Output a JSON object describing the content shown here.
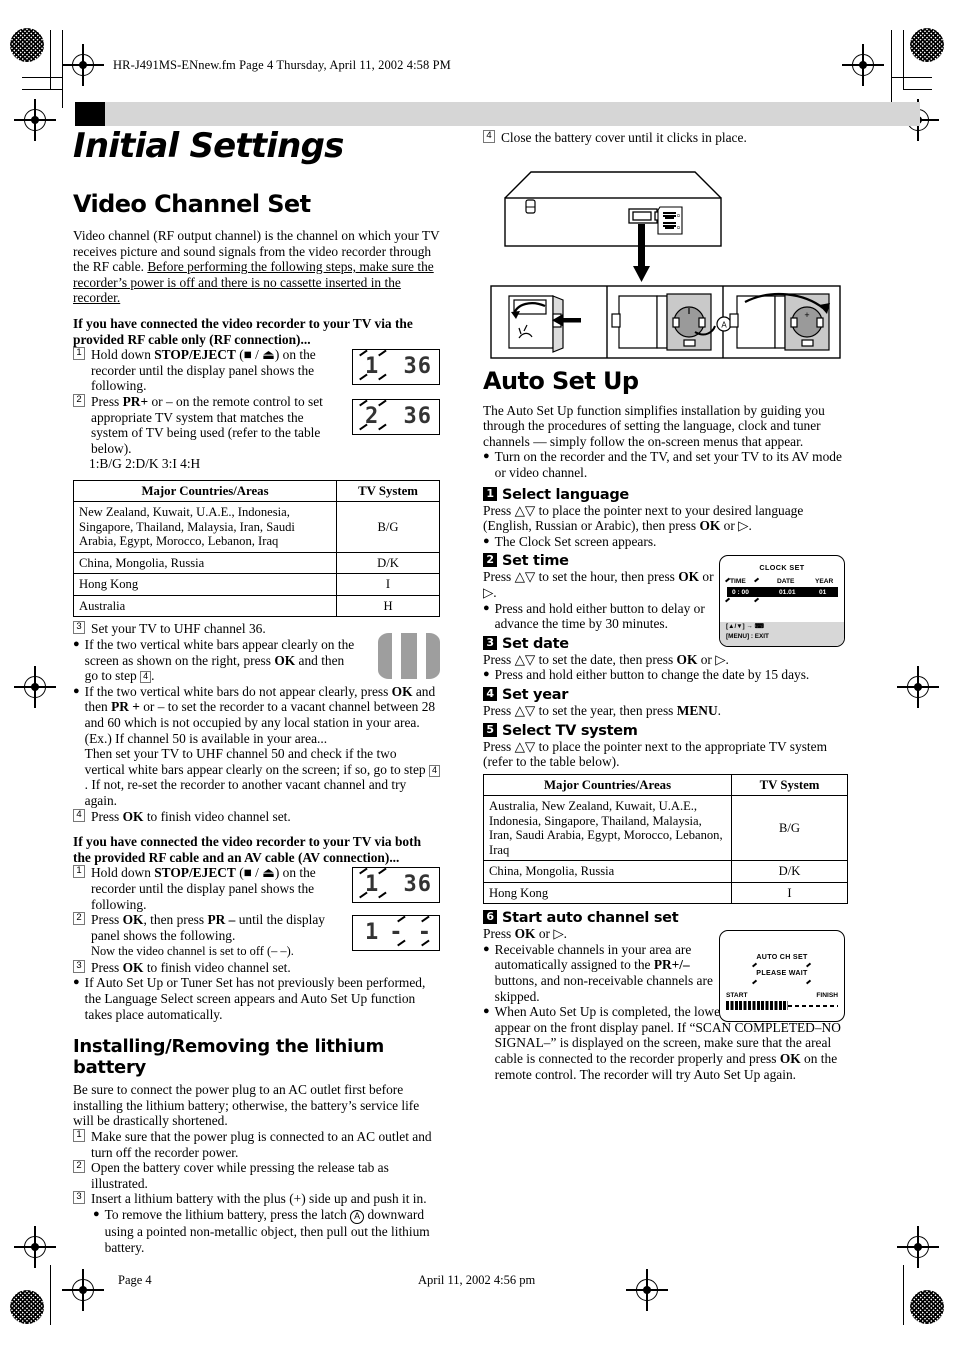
{
  "header": {
    "file_stamp": "HR-J491MS-ENnew.fm  Page 4  Thursday, April 11, 2002  4:58 PM",
    "chapter_title": "Initial Settings"
  },
  "footer": {
    "page_label": "Page 4",
    "date_label": "April 11, 2002 4:56 pm"
  },
  "left": {
    "section_title": "Video Channel Set",
    "intro_normal": "Video channel (RF output channel) is the channel on which your TV receives picture and sound signals from the video recorder through the RF cable. ",
    "intro_underlined": "Before performing the following steps, make sure the recorder’s power is off and there is no cassette inserted in the recorder.",
    "rf_heading": "If you have connected the video recorder to your TV via the provided RF cable only (RF connection)...",
    "rf_step1_pre": "Hold down ",
    "rf_step1_bold": "STOP/EJECT",
    "rf_step1_post": " (■ / ⏏) on the recorder until the display panel shows the following.",
    "rf_step2_pre": "Press ",
    "rf_step2_bold": "PR+",
    "rf_step2_post": " or – on the remote control to set appropriate TV system that matches the system of TV being used (refer to the table below).",
    "rf_systems_line": "1:B/G  2:D/K  3:I  4:H",
    "lcd1": {
      "left": "1",
      "right": "36"
    },
    "lcd2": {
      "left": "2",
      "right": "36"
    },
    "table": {
      "headers": [
        "Major Countries/Areas",
        "TV System"
      ],
      "rows": [
        [
          "New Zealand, Kuwait, U.A.E., Indonesia, Singapore, Thailand, Malaysia, Iran, Saudi Arabia, Egypt, Morocco, Lebanon, Iraq",
          "B/G"
        ],
        [
          "China, Mongolia, Russia",
          "D/K"
        ],
        [
          "Hong Kong",
          "I"
        ],
        [
          "Australia",
          "H"
        ]
      ]
    },
    "rf_step3": "Set your TV to UHF channel 36.",
    "rf_b1_a": "If the two vertical white bars appear clearly on the screen as shown on the right, press ",
    "rf_b1_bold": "OK",
    "rf_b1_b": " and then go to step ",
    "rf_b1_step": "4",
    "rf_b1_c": ".",
    "rf_b2_a": "If the two vertical white bars do not appear clearly, press ",
    "rf_b2_bold1": "OK",
    "rf_b2_b": " and then ",
    "rf_b2_bold2": "PR +",
    "rf_b2_c": " or – to set the recorder to a vacant channel between 28 and 60 which is not occupied by any local station in your area.",
    "rf_b2_d": "(Ex.) If channel 50 is available in your area...",
    "rf_b2_e": "Then set your TV to UHF channel 50 and check if the two vertical white bars appear clearly on the screen; if so, go to step ",
    "rf_b2_step": "4",
    "rf_b2_f": ". If not, re-set the recorder to another vacant channel and try again.",
    "rf_step4_pre": "Press ",
    "rf_step4_bold": "OK",
    "rf_step4_post": " to finish video channel set.",
    "av_heading": "If you have connected the video recorder to your TV via both the provided RF cable and an AV cable (AV connection)...",
    "av_step1_pre": "Hold down ",
    "av_step1_bold": "STOP/EJECT",
    "av_step1_post": " (■ / ⏏) on the recorder until the display panel shows the following.",
    "av_step2_pre": "Press ",
    "av_step2_bold1": "OK",
    "av_step2_mid": ", then press ",
    "av_step2_bold2": "PR –",
    "av_step2_post": " until the display panel shows the following.",
    "av_step2_extra": "Now the video channel is set to off (– –).",
    "av_step3_pre": "Press ",
    "av_step3_bold": "OK",
    "av_step3_post": " to finish video channel set.",
    "av_bullet": "If Auto Set Up or Tuner Set has not previously been performed, the Language Select screen appears and Auto Set Up function takes place automatically.",
    "lcd3": {
      "left": "1",
      "right": "36"
    },
    "lcd4": {
      "left": "1",
      "right": "- -"
    },
    "battery_title": "Installing/Removing the lithium battery",
    "battery_intro": "Be sure to connect the power plug to an AC outlet first before installing the lithium battery; otherwise, the battery’s service life will be drastically shortened.",
    "bat_step1": "Make sure that the power plug is connected to an AC outlet and turn off the recorder power.",
    "bat_step2": "Open the battery cover while pressing the release tab as illustrated.",
    "bat_step3": "Insert a lithium battery with the plus (+) side up and push it in.",
    "bat_b1_a": "To remove the lithium battery, press the latch ",
    "bat_b1_mark": "A",
    "bat_b1_b": " downward using a pointed non-metallic object, then pull out the lithium battery."
  },
  "right": {
    "bat_step4": "Close the battery cover until it clicks in place.",
    "latch_mark": "A",
    "section_title": "Auto Set Up",
    "intro": "The Auto Set Up function simplifies installation by guiding you through the procedures of setting the language, clock and tuner channels — simply follow the on-screen menus that appear.",
    "intro_bullet": "Turn on the recorder and the TV, and set your TV to its AV mode or video channel.",
    "steps": [
      {
        "num": "1",
        "title": "Select language"
      },
      {
        "num": "2",
        "title": "Set time"
      },
      {
        "num": "3",
        "title": "Set date"
      },
      {
        "num": "4",
        "title": "Set year"
      },
      {
        "num": "5",
        "title": "Select TV system"
      },
      {
        "num": "6",
        "title": "Start auto channel set"
      }
    ],
    "s1_a": "Press △▽ to place the pointer next to your desired language (English, Russian or Arabic), then press ",
    "s1_bold": "OK",
    "s1_b": " or ▷.",
    "s1_bullet": "The Clock Set screen appears.",
    "s2_a": "Press △▽ to set the hour, then press ",
    "s2_bold": "OK",
    "s2_b": " or ▷.",
    "s2_bullet": "Press and hold either button to delay or advance the time by 30 minutes.",
    "s3_a": "Press △▽ to set the date, then press ",
    "s3_bold": "OK",
    "s3_b": " or ▷.",
    "s3_bullet": "Press and hold either button to change the date by 15 days.",
    "s4_a": "Press △▽ to set the year, then press ",
    "s4_bold": "MENU",
    "s4_b": ".",
    "s5_a": "Press △▽ to place the pointer next to the appropriate TV system (refer to the table below).",
    "table": {
      "headers": [
        "Major Countries/Areas",
        "TV System"
      ],
      "rows": [
        [
          "Australia, New Zealand, Kuwait, U.A.E., Indonesia, Singapore, Thailand, Malaysia, Iran, Saudi Arabia, Egypt, Morocco, Lebanon, Iraq",
          "B/G"
        ],
        [
          "China, Mongolia, Russia",
          "D/K"
        ],
        [
          "Hong Kong",
          "I"
        ]
      ]
    },
    "s6_a": "Press ",
    "s6_bold": "OK",
    "s6_b": " or ▷.",
    "s6_bullet1_a": "Receivable channels in your area are automatically assigned to the ",
    "s6_bullet1_bold": "PR+/–",
    "s6_bullet1_b": " buttons, and non-receivable channels are skipped.",
    "s6_bullet2_a": "When Auto Set Up is completed, the lowest position number will appear on the front display panel. If “SCAN COMPLETED–NO SIGNAL–” is displayed on the screen, make sure that the areal cable is connected to the recorder properly and press ",
    "s6_bullet2_bold": "OK",
    "s6_bullet2_b": " on the remote control. The recorder will try Auto Set Up again.",
    "osd_clock": {
      "title": "CLOCK SET",
      "col_time": "TIME",
      "col_date": "DATE",
      "col_year": "YEAR",
      "val_time": "0 : 00",
      "val_date": "01.01",
      "val_year": "01",
      "foot_line1": "[▲/▼] → ⌨",
      "foot_line2": "[MENU] : EXIT"
    },
    "osd_autoch": {
      "title": "AUTO CH SET",
      "subtitle": "PLEASE WAIT",
      "start": "START",
      "finish": "FINISH"
    }
  },
  "colors": {
    "gray_bar": "#d6d6d6",
    "tv_screen_gray": "#9e9e9e",
    "osd_footer_gray": "#d7d7d7"
  }
}
